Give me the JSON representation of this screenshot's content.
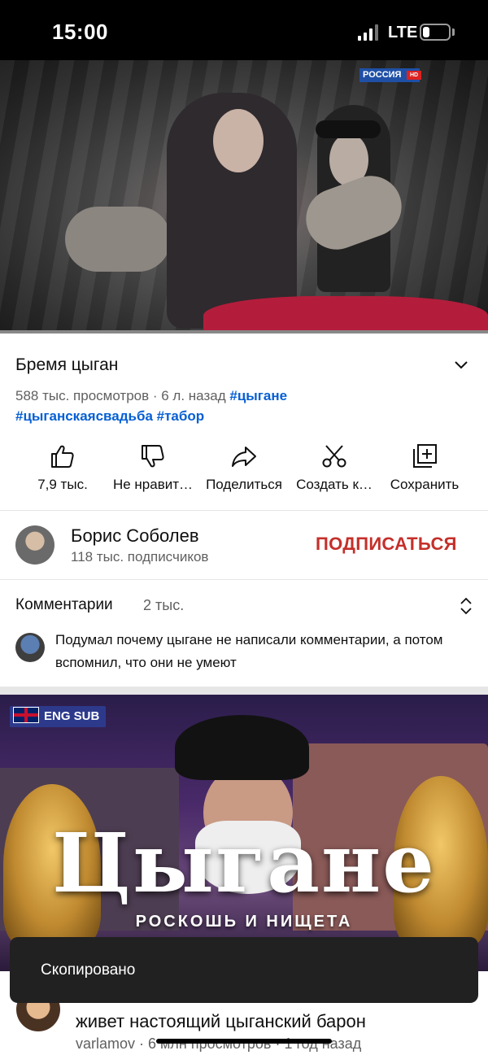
{
  "status_bar": {
    "time": "15:00",
    "network": "LTE",
    "battery_level": 0.25
  },
  "player": {
    "channel_logo": "РОССИЯ",
    "channel_logo_hd": "HD"
  },
  "video": {
    "title": "Бремя цыган",
    "views_age": "588 тыс. просмотров · 6 л. назад",
    "tags": [
      "#цыгане",
      "#цыганскаясвадьба",
      "#табор"
    ]
  },
  "actions": [
    {
      "label": "7,9 тыс.",
      "icon": "thumbs-up-icon"
    },
    {
      "label": "Не нравит…",
      "icon": "thumbs-down-icon"
    },
    {
      "label": "Поделиться",
      "icon": "share-icon"
    },
    {
      "label": "Создать к…",
      "icon": "scissors-icon"
    },
    {
      "label": "Сохранить",
      "icon": "add-to-playlist-icon"
    }
  ],
  "channel": {
    "name": "Борис Соболев",
    "subscribers": "118 тыс. подписчиков",
    "subscribe_label": "ПОДПИСАТЬСЯ"
  },
  "comments": {
    "label": "Комментарии",
    "count": "2 тыс.",
    "top_comment": "Подумал почему цыгане не написали комментарии, а потом вспомнил, что они не умеют"
  },
  "next_video": {
    "badge": "ENG SUB",
    "thumb_title": "Цыгане",
    "thumb_subtitle": "РОСКОШЬ И НИЩЕТА",
    "title": "живет настоящий цыганский барон",
    "channel": "varlamov",
    "meta": "6 млн просмотров · 1 год назад"
  },
  "toast": {
    "text": "Скопировано"
  },
  "colors": {
    "subscribe": "#c4302b",
    "tag": "#065fd4",
    "toast_bg": "#212121"
  }
}
